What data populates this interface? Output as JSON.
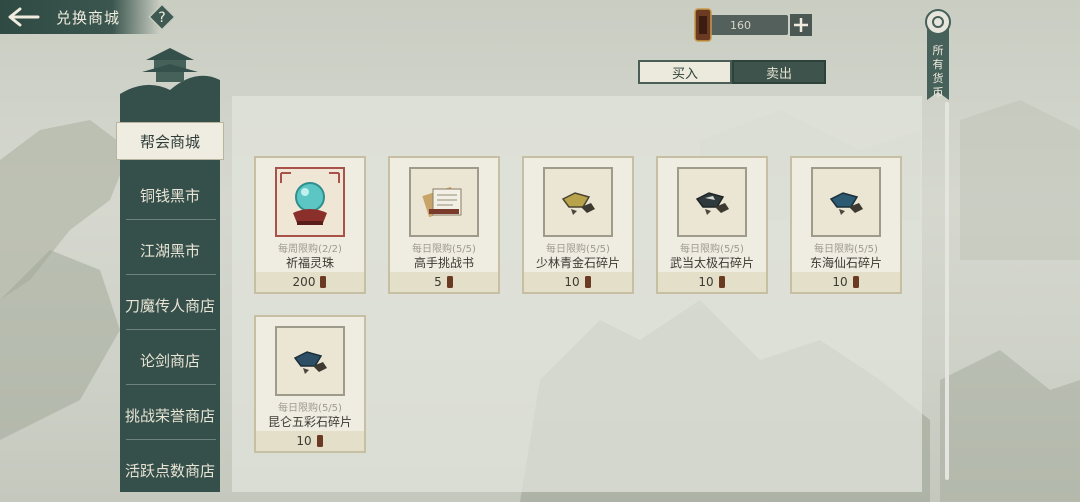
{
  "header": {
    "title": "兑换商城",
    "help_icon": "question-icon",
    "back_icon": "back-arrow-icon"
  },
  "currency": {
    "amount": "160",
    "icon": "coin-token-icon",
    "add_icon": "plus-icon"
  },
  "trade_tabs": [
    {
      "label": "买入"
    },
    {
      "label": "卖出"
    }
  ],
  "all_currency": {
    "label_1": "所",
    "label_2": "有",
    "label_3": "货",
    "label_4": "币"
  },
  "sidebar": {
    "items": [
      {
        "label": "帮会商城"
      },
      {
        "label": "铜钱黑市"
      },
      {
        "label": "江湖黑市"
      },
      {
        "label": "刀魔传人商店"
      },
      {
        "label": "论剑商店"
      },
      {
        "label": "挑战荣誉商店"
      },
      {
        "label": "活跃点数商店"
      }
    ]
  },
  "items": [
    {
      "limit": "每周限购(2/2)",
      "name": "祈福灵珠",
      "price": "200",
      "icon": "crystal-orb-icon"
    },
    {
      "limit": "每日限购(5/5)",
      "name": "高手挑战书",
      "price": "5",
      "icon": "scroll-book-icon"
    },
    {
      "limit": "每日限购(5/5)",
      "name": "少林青金石碎片",
      "price": "10",
      "icon": "stone-shard-icon"
    },
    {
      "limit": "每日限购(5/5)",
      "name": "武当太极石碎片",
      "price": "10",
      "icon": "stone-shard-icon"
    },
    {
      "limit": "每日限购(5/5)",
      "name": "东海仙石碎片",
      "price": "10",
      "icon": "stone-shard-icon"
    },
    {
      "limit": "每日限购(5/5)",
      "name": "昆仑五彩石碎片",
      "price": "10",
      "icon": "stone-shard-icon"
    }
  ]
}
